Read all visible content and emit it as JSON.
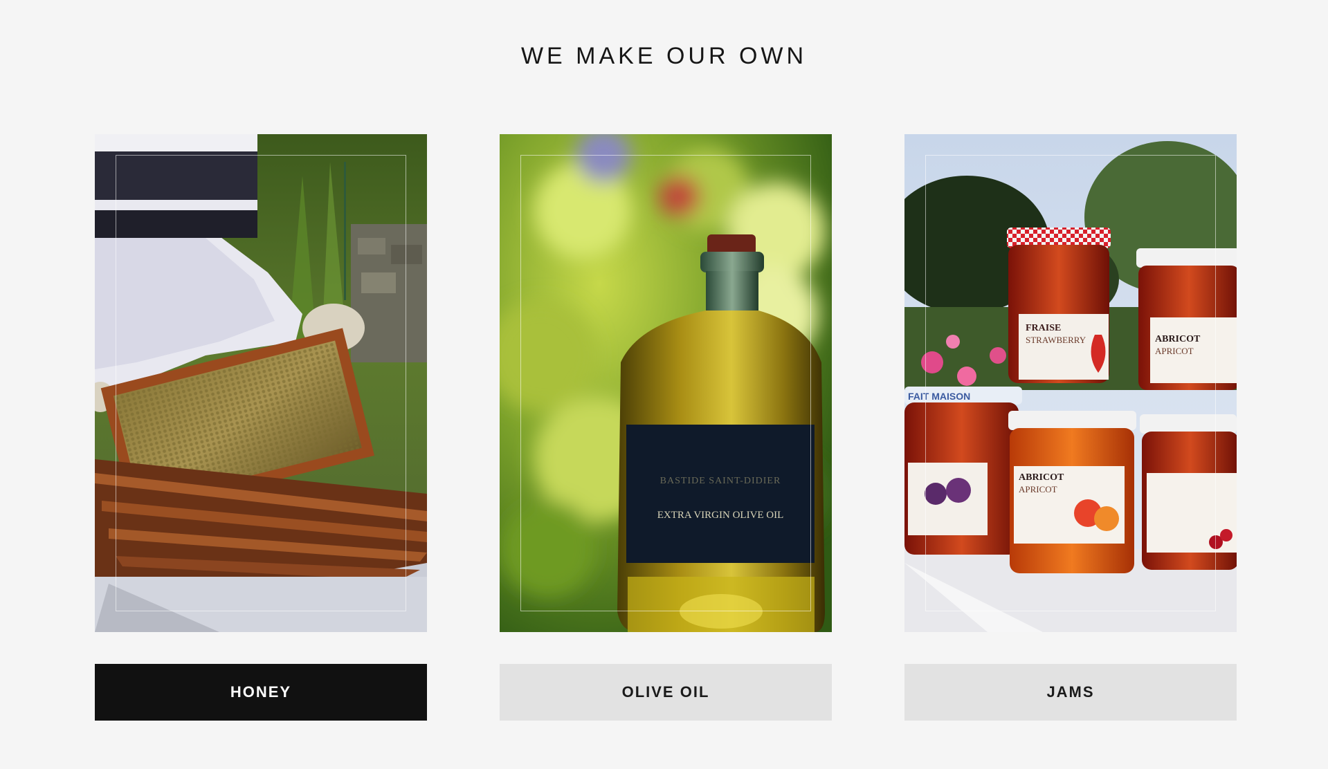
{
  "section": {
    "title": "WE MAKE OUR OWN"
  },
  "cards": [
    {
      "label": "HONEY",
      "active": true,
      "image_subject": "beekeeper holding honeycomb frame over hive"
    },
    {
      "label": "OLIVE OIL",
      "active": false,
      "image_subject": "bottle of olive oil with black label",
      "bottle_label": {
        "line1": "BASTIDE SAINT-DIDIER",
        "line2": "EXTRA VIRGIN OLIVE OIL"
      }
    },
    {
      "label": "JAMS",
      "active": false,
      "image_subject": "jars of homemade jam",
      "jar_labels": [
        {
          "line1": "FRAISE",
          "line2": "STRAWBERRY"
        },
        {
          "line1": "ABRICOT",
          "line2": "APRICOT"
        },
        {
          "line1": "ABRICOT",
          "line2": "APRICOT"
        },
        {
          "line1": "FAIT MAISON",
          "line2": ""
        }
      ]
    }
  ],
  "colors": {
    "background": "#f5f5f5",
    "active_button": "#111111",
    "inactive_button": "#e2e2e2"
  }
}
